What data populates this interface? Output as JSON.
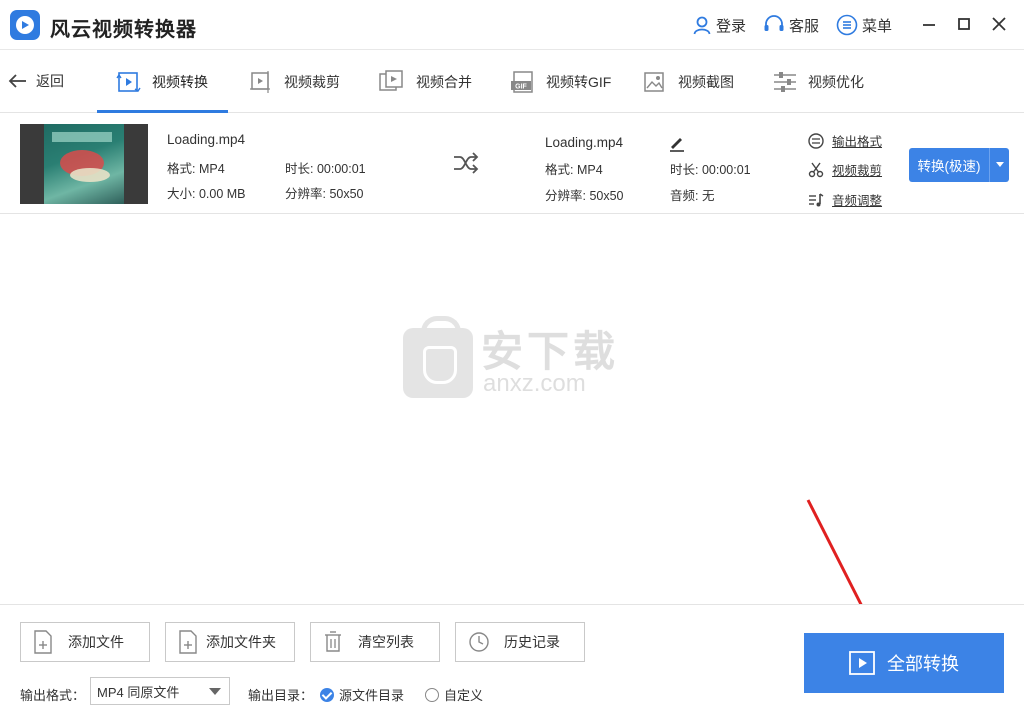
{
  "app": {
    "title": "风云视频转换器"
  },
  "titlebar": {
    "login_label": "登录",
    "service_label": "客服",
    "menu_label": "菜单"
  },
  "nav": {
    "back_label": "返回",
    "tabs": [
      {
        "label": "视频转换",
        "icon": "video-convert-icon",
        "active": true
      },
      {
        "label": "视频裁剪",
        "icon": "video-crop-icon"
      },
      {
        "label": "视频合并",
        "icon": "video-merge-icon"
      },
      {
        "label": "视频转GIF",
        "icon": "gif-icon"
      },
      {
        "label": "视频截图",
        "icon": "screenshot-icon"
      },
      {
        "label": "视频优化",
        "icon": "optimize-icon"
      }
    ]
  },
  "file": {
    "source": {
      "name": "Loading.mp4",
      "format": "格式: MP4",
      "duration": "时长: 00:00:01",
      "size": "大小: 0.00 MB",
      "resolution": "分辨率: 50x50"
    },
    "output": {
      "name": "Loading.mp4",
      "format": "格式: MP4",
      "duration": "时长: 00:00:01",
      "resolution": "分辨率: 50x50",
      "audio": "音频: 无"
    },
    "links": {
      "output_format": "输出格式",
      "video_crop": "视频裁剪",
      "audio_adjust": "音频调整"
    },
    "convert_button": "转换(极速)"
  },
  "watermark": {
    "text": "安下载",
    "sub": "anxz.com"
  },
  "bottom": {
    "add_file": "添加文件",
    "add_folder": "添加文件夹",
    "clear_list": "清空列表",
    "history": "历史记录",
    "convert_all": "全部转换",
    "output_format_label": "输出格式：",
    "output_format_value": "MP4 同原文件",
    "output_dir_label": "输出目录：",
    "dir_option_source": "源文件目录",
    "dir_option_custom": "自定义"
  },
  "colors": {
    "accent": "#3c83e6",
    "annotation": "#e02020"
  }
}
